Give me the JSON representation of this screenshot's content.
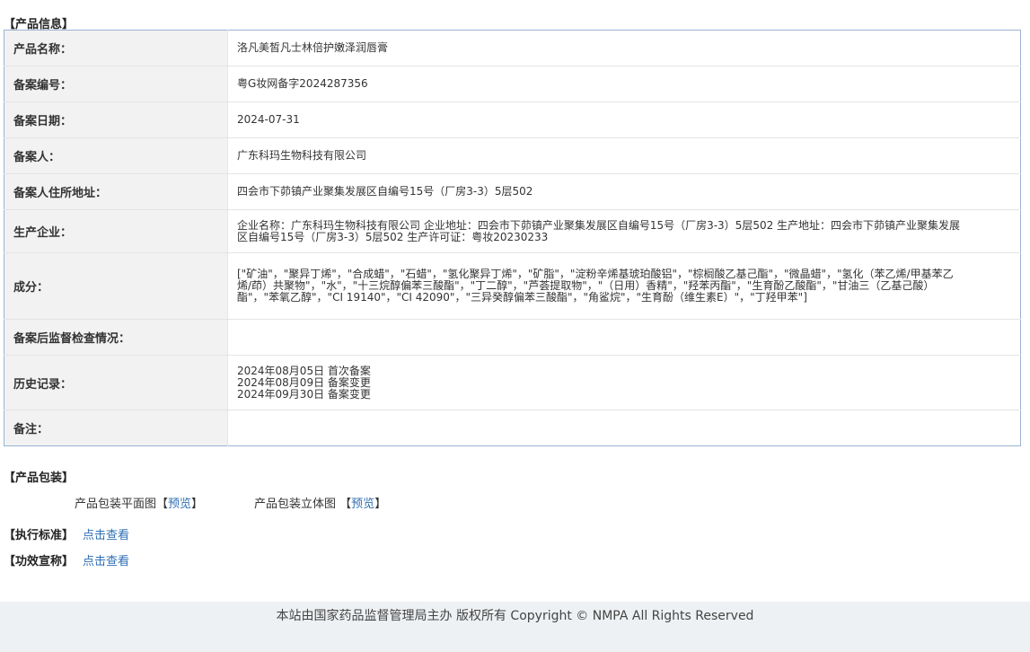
{
  "sections": {
    "info_title": "【产品信息】",
    "pack_title": "【产品包装】"
  },
  "rows": [
    {
      "label": "产品名称：",
      "value": "洛凡美皙凡士林倍护嫩泽润唇膏"
    },
    {
      "label": "备案编号：",
      "value": "粤G妆网备字2024287356"
    },
    {
      "label": "备案日期：",
      "value": "2024-07-31"
    },
    {
      "label": "备案人：",
      "value": "广东科玛生物科技有限公司"
    },
    {
      "label": "备案人住所地址：",
      "value": "四会市下茆镇产业聚集发展区自编号15号（厂房3-3）5层502"
    },
    {
      "label": "生产企业：",
      "value": "企业名称：广东科玛生物科技有限公司 企业地址：四会市下茆镇产业聚集发展区自编号15号（厂房3-3）5层502 生产地址：四会市下茆镇产业聚集发展区自编号15号（厂房3-3）5层502 生产许可证：粤妆20230233"
    },
    {
      "label": "成分：",
      "value": "[\"矿油\"，\"聚异丁烯\"，\"合成蜡\"，\"石蜡\"，\"氢化聚异丁烯\"，\"矿脂\"，\"淀粉辛烯基琥珀酸铝\"，\"棕榈酸乙基己酯\"，\"微晶蜡\"，\"氢化（苯乙烯/甲基苯乙烯/茚）共聚物\"，\"水\"，\"十三烷醇偏苯三酸酯\"，\"丁二醇\"，\"芦荟提取物\"，\"（日用）香精\"，\"羟苯丙酯\"，\"生育酚乙酸酯\"，\"甘油三（乙基己酸）酯\"，\"苯氧乙醇\"，\"CI 19140\"，\"CI 42090\"，\"三异癸醇偏苯三酸酯\"，\"角鲨烷\"，\"生育酚（维生素E）\"，\"丁羟甲苯\"]"
    },
    {
      "label": "备案后监督检查情况：",
      "value": ""
    },
    {
      "label": "历史记录：",
      "value": "2024年08月05日 首次备案\n2024年08月09日 备案变更\n2024年09月30日 备案变更"
    },
    {
      "label": "备注：",
      "value": ""
    }
  ],
  "packaging": {
    "flat_label": "产品包装平面图",
    "three_d_label": "产品包装立体图",
    "preview_link": "预览",
    "bracket_open": "【",
    "bracket_close": "】"
  },
  "standard": {
    "title": "【执行标准】",
    "link": "点击查看"
  },
  "claims": {
    "title": "【功效宣称】",
    "link": "点击查看"
  },
  "footer": {
    "text": "本站由国家药品监督管理局主办 版权所有 Copyright © NMPA All Rights Reserved"
  },
  "colors": {
    "link": "#2f6fb3",
    "label_bg": "#f2f2f2",
    "table_border": "#9ab4d4",
    "footer_bg": "#eef1f3"
  }
}
